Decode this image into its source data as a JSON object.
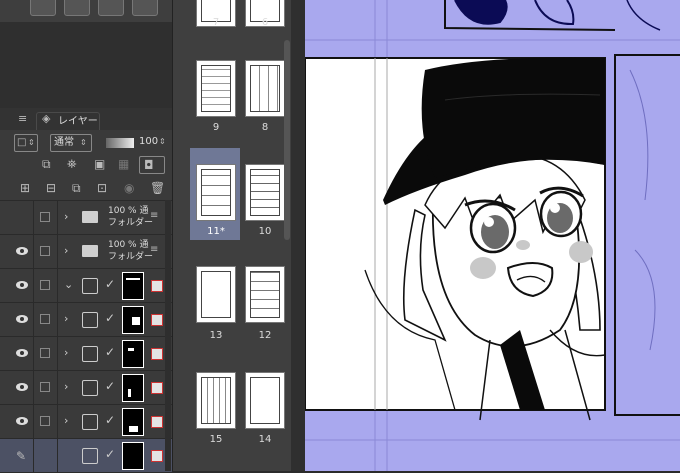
{
  "layer_panel": {
    "title": "レイヤー",
    "blend_mode": "通常",
    "opacity": "100",
    "layers": [
      {
        "type": "folder",
        "opacity": "100 %",
        "blend": "通",
        "name": "フォルダー",
        "expanded": false
      },
      {
        "type": "folder",
        "opacity": "100 %",
        "blend": "通",
        "name": "フォルダー",
        "expanded": false
      },
      {
        "type": "adjust",
        "expanded": true
      },
      {
        "type": "adjust",
        "expanded": false
      },
      {
        "type": "adjust",
        "expanded": false
      },
      {
        "type": "adjust",
        "expanded": false
      },
      {
        "type": "adjust",
        "expanded": false
      },
      {
        "type": "adjust",
        "expanded": false,
        "selected": true
      }
    ]
  },
  "pages_panel": {
    "pages": [
      {
        "label": "7"
      },
      {
        "label": "6"
      },
      {
        "label": "9"
      },
      {
        "label": "8"
      },
      {
        "label": "11*",
        "selected": true
      },
      {
        "label": "10"
      },
      {
        "label": "13"
      },
      {
        "label": "12"
      },
      {
        "label": "15"
      },
      {
        "label": "14"
      }
    ]
  },
  "colors": {
    "canvas_bg": "#a9a8ee",
    "selected_page": "#6f7896",
    "panel_bg": "#3a3a3a"
  }
}
